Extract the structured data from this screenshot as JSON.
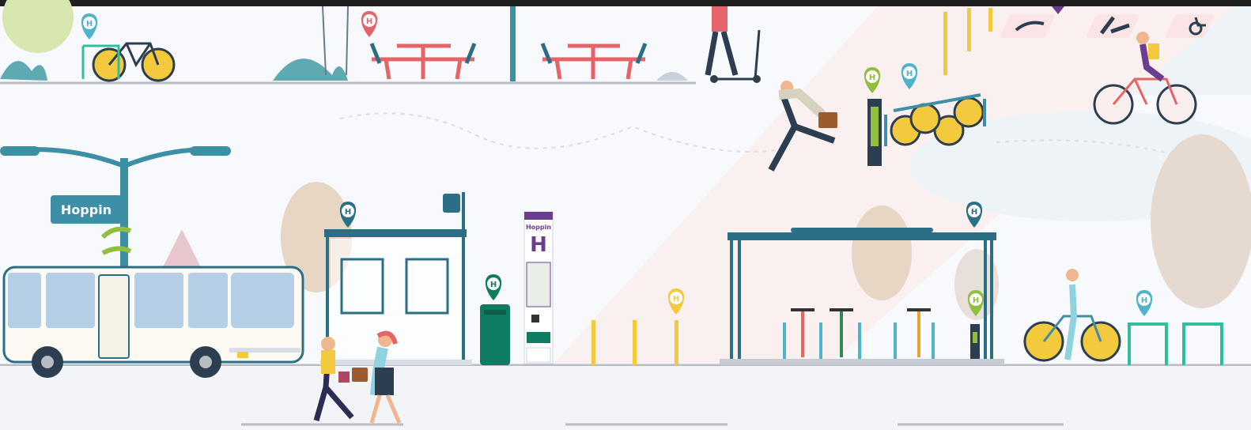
{
  "scene": {
    "title": "",
    "brand": {
      "name": "Hoppin",
      "totem_label": "Hoppin",
      "pin_glyph": "H"
    },
    "colors": {
      "teal": "#3d8fa6",
      "teal_dark": "#2a6f85",
      "green": "#0e7c62",
      "lime": "#8fbf3c",
      "yellow": "#f3c93e",
      "coral": "#e5646a",
      "purple": "#6b3d8f",
      "sky": "#4fb3cb"
    },
    "pins": [
      {
        "name": "pin-bike-parking",
        "color": "#4fb3cb"
      },
      {
        "name": "pin-picnic-area",
        "color": "#e5646a"
      },
      {
        "name": "pin-bus-shelter",
        "color": "#2a6f85"
      },
      {
        "name": "pin-waste-bin",
        "color": "#0e7c62"
      },
      {
        "name": "pin-bollards",
        "color": "#f3c93e"
      },
      {
        "name": "pin-bike-shelter",
        "color": "#2a6f85"
      },
      {
        "name": "pin-charging-post",
        "color": "#8fbf3c"
      },
      {
        "name": "pin-bike-rack",
        "color": "#4fb3cb"
      },
      {
        "name": "pin-shared-bikes-a",
        "color": "#8fbf3c"
      },
      {
        "name": "pin-shared-bikes-b",
        "color": "#4fb3cb"
      }
    ],
    "icons": [
      "bus-icon",
      "bicycle-icon",
      "scooter-icon",
      "parking-ev-icon",
      "carpool-icon",
      "wheelchair-icon",
      "map-pin-icon"
    ]
  }
}
